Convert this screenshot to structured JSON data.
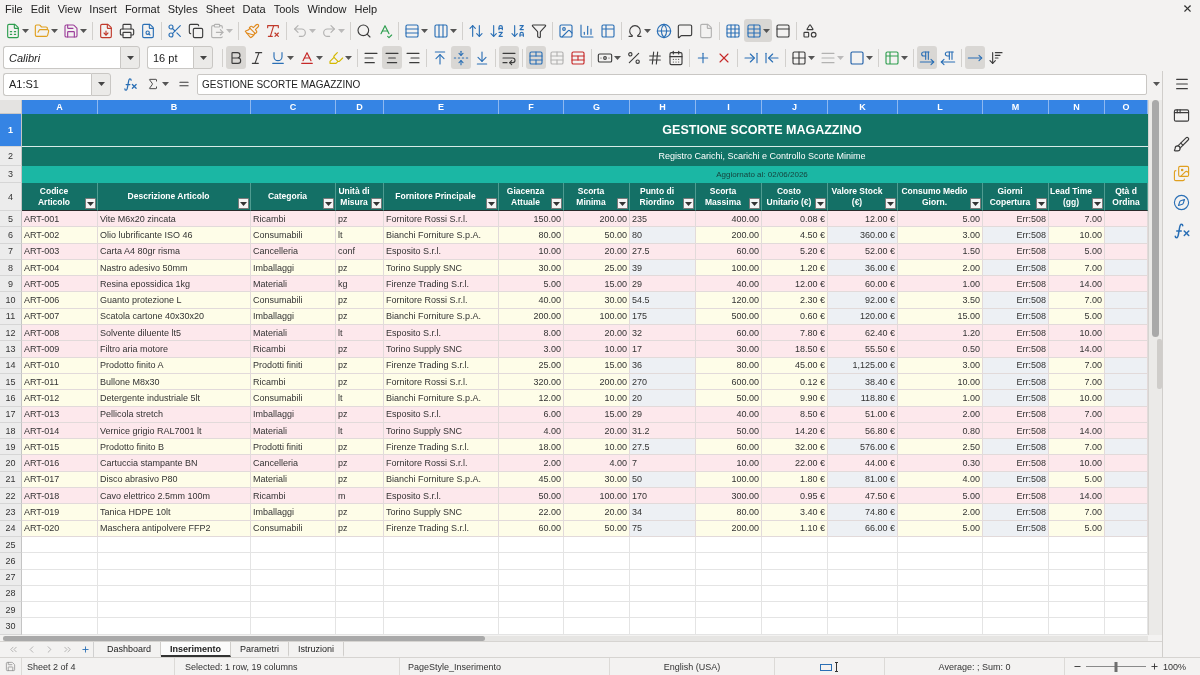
{
  "menu_bar": [
    "File",
    "Edit",
    "View",
    "Insert",
    "Format",
    "Styles",
    "Sheet",
    "Data",
    "Tools",
    "Window",
    "Help"
  ],
  "standard_toolbar": [
    {
      "pressed": false,
      "disabled": false,
      "dropdown": true
    },
    {
      "pressed": false,
      "disabled": false,
      "dropdown": true
    },
    {
      "pressed": false,
      "disabled": false,
      "dropdown": true
    },
    {
      "pressed": false,
      "disabled": false,
      "dropdown": false
    },
    {
      "pressed": false,
      "disabled": false,
      "dropdown": false
    },
    {
      "pressed": false,
      "disabled": false,
      "dropdown": false
    },
    {
      "pressed": false,
      "disabled": false,
      "dropdown": false
    },
    {
      "pressed": false,
      "disabled": false,
      "dropdown": false
    },
    {
      "pressed": false,
      "disabled": true,
      "dropdown": true
    },
    {
      "pressed": false,
      "disabled": false,
      "dropdown": false
    },
    {
      "pressed": false,
      "disabled": false,
      "dropdown": false
    },
    {
      "pressed": false,
      "disabled": true,
      "dropdown": true
    },
    {
      "pressed": false,
      "disabled": true,
      "dropdown": true
    },
    {
      "pressed": false,
      "disabled": false,
      "dropdown": false
    },
    {
      "pressed": false,
      "disabled": false,
      "dropdown": false
    },
    {
      "pressed": false,
      "disabled": false,
      "dropdown": true
    },
    {
      "pressed": false,
      "disabled": false,
      "dropdown": true
    },
    {
      "pressed": false,
      "disabled": false,
      "dropdown": false
    },
    {
      "pressed": false,
      "disabled": false,
      "dropdown": false
    },
    {
      "pressed": false,
      "disabled": false,
      "dropdown": false
    },
    {
      "pressed": false,
      "disabled": false,
      "dropdown": false
    },
    {
      "pressed": false,
      "disabled": false,
      "dropdown": false
    },
    {
      "pressed": false,
      "disabled": false,
      "dropdown": false
    },
    {
      "pressed": false,
      "disabled": false,
      "dropdown": false
    },
    {
      "pressed": false,
      "disabled": false,
      "dropdown": true
    },
    {
      "pressed": false,
      "disabled": false,
      "dropdown": false
    },
    {
      "pressed": false,
      "disabled": false,
      "dropdown": false
    },
    {
      "pressed": false,
      "disabled": true,
      "dropdown": false
    },
    {
      "pressed": false,
      "disabled": false,
      "dropdown": false
    },
    {
      "pressed": true,
      "disabled": false,
      "dropdown": true
    },
    {
      "pressed": false,
      "disabled": false,
      "dropdown": false
    },
    {
      "pressed": false,
      "disabled": false,
      "dropdown": false
    }
  ],
  "formatting_toolbar": {
    "font_name": "Calibri",
    "font_size": "16 pt",
    "buttons": [
      {
        "pressed": true,
        "disabled": false,
        "dropdown": false
      },
      {
        "pressed": false,
        "disabled": false,
        "dropdown": false
      },
      {
        "pressed": false,
        "disabled": false,
        "dropdown": true
      },
      {
        "pressed": false,
        "disabled": false,
        "dropdown": true
      },
      {
        "pressed": false,
        "disabled": false,
        "dropdown": true
      },
      {
        "pressed": false,
        "disabled": false,
        "dropdown": false
      },
      {
        "pressed": true,
        "disabled": false,
        "dropdown": false
      },
      {
        "pressed": false,
        "disabled": false,
        "dropdown": false
      },
      {
        "pressed": false,
        "disabled": false,
        "dropdown": false
      },
      {
        "pressed": true,
        "disabled": false,
        "dropdown": false
      },
      {
        "pressed": false,
        "disabled": false,
        "dropdown": false
      },
      {
        "pressed": true,
        "disabled": false,
        "dropdown": false
      },
      {
        "pressed": true,
        "disabled": false,
        "dropdown": false
      },
      {
        "pressed": false,
        "disabled": true,
        "dropdown": false
      },
      {
        "pressed": false,
        "disabled": false,
        "dropdown": false
      },
      {
        "pressed": false,
        "disabled": false,
        "dropdown": true
      },
      {
        "pressed": false,
        "disabled": false,
        "dropdown": false
      },
      {
        "pressed": false,
        "disabled": false,
        "dropdown": false
      },
      {
        "pressed": false,
        "disabled": false,
        "dropdown": false
      },
      {
        "pressed": false,
        "disabled": false,
        "dropdown": false
      },
      {
        "pressed": false,
        "disabled": false,
        "dropdown": false
      },
      {
        "pressed": false,
        "disabled": false,
        "dropdown": false
      },
      {
        "pressed": false,
        "disabled": false,
        "dropdown": false
      },
      {
        "pressed": false,
        "disabled": false,
        "dropdown": true
      },
      {
        "pressed": false,
        "disabled": true,
        "dropdown": true
      },
      {
        "pressed": false,
        "disabled": false,
        "dropdown": true
      },
      {
        "pressed": false,
        "disabled": false,
        "dropdown": true
      },
      {
        "pressed": true,
        "disabled": false,
        "dropdown": false
      },
      {
        "pressed": false,
        "disabled": false,
        "dropdown": false
      },
      {
        "pressed": true,
        "disabled": false,
        "dropdown": false
      },
      {
        "pressed": false,
        "disabled": false,
        "dropdown": false
      }
    ]
  },
  "formula_bar": {
    "name_box": "A1:S1",
    "formula": "GESTIONE SCORTE MAGAZZINO"
  },
  "sheet": {
    "columns": [
      {
        "letter": "A",
        "selected": true,
        "shaded": false
      },
      {
        "letter": "B",
        "selected": true,
        "shaded": false
      },
      {
        "letter": "C",
        "selected": true,
        "shaded": false
      },
      {
        "letter": "D",
        "selected": true,
        "shaded": false
      },
      {
        "letter": "E",
        "selected": true,
        "shaded": false
      },
      {
        "letter": "F",
        "selected": true,
        "shaded": false
      },
      {
        "letter": "G",
        "selected": true,
        "shaded": false
      },
      {
        "letter": "H",
        "selected": true,
        "shaded": true
      },
      {
        "letter": "I",
        "selected": true,
        "shaded": false
      },
      {
        "letter": "J",
        "selected": true,
        "shaded": false
      },
      {
        "letter": "K",
        "selected": true,
        "shaded": true
      },
      {
        "letter": "L",
        "selected": true,
        "shaded": false
      },
      {
        "letter": "M",
        "selected": true,
        "shaded": true
      },
      {
        "letter": "N",
        "selected": true,
        "shaded": false
      },
      {
        "letter": "O",
        "selected": true,
        "shaded": true
      }
    ],
    "title_rows": [
      {
        "number": "1",
        "selected": true,
        "kind": "title",
        "text": "GESTIONE SCORTE MAGAZZINO"
      },
      {
        "number": "2",
        "selected": false,
        "kind": "subtitle",
        "text": "Registro Carichi, Scarichi e Controllo Scorte Minime"
      },
      {
        "number": "3",
        "selected": false,
        "kind": "note",
        "text": "Aggiornato al: 02/06/2026"
      }
    ],
    "header_row": {
      "number": "4",
      "selected": false,
      "cells": [
        {
          "label": "Codice\nArticolo",
          "filter": true
        },
        {
          "label": "Descrizione Articolo",
          "filter": true
        },
        {
          "label": "Categoria",
          "filter": true
        },
        {
          "label": "Unità di\nMisura",
          "filter": true
        },
        {
          "label": "Fornitore Principale",
          "filter": true
        },
        {
          "label": "Giacenza\nAttuale",
          "filter": true
        },
        {
          "label": "Scorta\nMinima",
          "filter": true
        },
        {
          "label": "Punto di\nRiordino",
          "filter": true
        },
        {
          "label": "Scorta\nMassima",
          "filter": true
        },
        {
          "label": "Costo\nUnitario (€)",
          "filter": true
        },
        {
          "label": "Valore Stock\n(€)",
          "filter": true
        },
        {
          "label": "Consumo Medio\nGiorn.",
          "filter": true
        },
        {
          "label": "Giorni\nCopertura",
          "filter": true
        },
        {
          "label": "Lead Time\n(gg)",
          "filter": true
        },
        {
          "label": "Qtà d\nOrdina",
          "filter": false
        }
      ]
    },
    "rows": [
      {
        "number": "5",
        "selected": false,
        "highlighted": true,
        "cells": [
          "ART-001",
          "Vite M6x20 zincata",
          "Ricambi",
          "pz",
          "Fornitore Rossi S.r.l.",
          "150.00",
          "200.00",
          "235",
          "400.00",
          "0.08 €",
          "12.00 €",
          "5.00",
          "Err:508",
          "7.00"
        ]
      },
      {
        "number": "6",
        "selected": false,
        "highlighted": false,
        "cells": [
          "ART-002",
          "Olio lubrificante ISO 46",
          "Consumabili",
          "lt",
          "Bianchi Forniture S.p.A.",
          "80.00",
          "50.00",
          "80",
          "200.00",
          "4.50 €",
          "360.00 €",
          "3.00",
          "Err:508",
          "10.00"
        ]
      },
      {
        "number": "7",
        "selected": false,
        "highlighted": true,
        "cells": [
          "ART-003",
          "Carta A4 80gr risma",
          "Cancelleria",
          "conf",
          "Esposito S.r.l.",
          "10.00",
          "20.00",
          "27.5",
          "60.00",
          "5.20 €",
          "52.00 €",
          "1.50",
          "Err:508",
          "5.00"
        ]
      },
      {
        "number": "8",
        "selected": false,
        "highlighted": false,
        "cells": [
          "ART-004",
          "Nastro adesivo 50mm",
          "Imballaggi",
          "pz",
          "Torino Supply SNC",
          "30.00",
          "25.00",
          "39",
          "100.00",
          "1.20 €",
          "36.00 €",
          "2.00",
          "Err:508",
          "7.00"
        ]
      },
      {
        "number": "9",
        "selected": false,
        "highlighted": true,
        "cells": [
          "ART-005",
          "Resina epossidica 1kg",
          "Materiali",
          "kg",
          "Firenze Trading S.r.l.",
          "5.00",
          "15.00",
          "29",
          "40.00",
          "12.00 €",
          "60.00 €",
          "1.00",
          "Err:508",
          "14.00"
        ]
      },
      {
        "number": "10",
        "selected": false,
        "highlighted": false,
        "cells": [
          "ART-006",
          "Guanto protezione L",
          "Consumabili",
          "pz",
          "Fornitore Rossi S.r.l.",
          "40.00",
          "30.00",
          "54.5",
          "120.00",
          "2.30 €",
          "92.00 €",
          "3.50",
          "Err:508",
          "7.00"
        ]
      },
      {
        "number": "11",
        "selected": false,
        "highlighted": false,
        "cells": [
          "ART-007",
          "Scatola cartone 40x30x20",
          "Imballaggi",
          "pz",
          "Bianchi Forniture S.p.A.",
          "200.00",
          "100.00",
          "175",
          "500.00",
          "0.60 €",
          "120.00 €",
          "15.00",
          "Err:508",
          "5.00"
        ]
      },
      {
        "number": "12",
        "selected": false,
        "highlighted": true,
        "cells": [
          "ART-008",
          "Solvente diluente lt5",
          "Materiali",
          "lt",
          "Esposito S.r.l.",
          "8.00",
          "20.00",
          "32",
          "60.00",
          "7.80 €",
          "62.40 €",
          "1.20",
          "Err:508",
          "10.00"
        ]
      },
      {
        "number": "13",
        "selected": false,
        "highlighted": true,
        "cells": [
          "ART-009",
          "Filtro aria motore",
          "Ricambi",
          "pz",
          "Torino Supply SNC",
          "3.00",
          "10.00",
          "17",
          "30.00",
          "18.50 €",
          "55.50 €",
          "0.50",
          "Err:508",
          "14.00"
        ]
      },
      {
        "number": "14",
        "selected": false,
        "highlighted": false,
        "cells": [
          "ART-010",
          "Prodotto finito A",
          "Prodotti finiti",
          "pz",
          "Firenze Trading S.r.l.",
          "25.00",
          "15.00",
          "36",
          "80.00",
          "45.00 €",
          "1,125.00 €",
          "3.00",
          "Err:508",
          "7.00"
        ]
      },
      {
        "number": "15",
        "selected": false,
        "highlighted": false,
        "cells": [
          "ART-011",
          "Bullone M8x30",
          "Ricambi",
          "pz",
          "Fornitore Rossi S.r.l.",
          "320.00",
          "200.00",
          "270",
          "600.00",
          "0.12 €",
          "38.40 €",
          "10.00",
          "Err:508",
          "7.00"
        ]
      },
      {
        "number": "16",
        "selected": false,
        "highlighted": false,
        "cells": [
          "ART-012",
          "Detergente industriale 5lt",
          "Consumabili",
          "lt",
          "Bianchi Forniture S.p.A.",
          "12.00",
          "10.00",
          "20",
          "50.00",
          "9.90 €",
          "118.80 €",
          "1.00",
          "Err:508",
          "10.00"
        ]
      },
      {
        "number": "17",
        "selected": false,
        "highlighted": true,
        "cells": [
          "ART-013",
          "Pellicola stretch",
          "Imballaggi",
          "pz",
          "Esposito S.r.l.",
          "6.00",
          "15.00",
          "29",
          "40.00",
          "8.50 €",
          "51.00 €",
          "2.00",
          "Err:508",
          "7.00"
        ]
      },
      {
        "number": "18",
        "selected": false,
        "highlighted": true,
        "cells": [
          "ART-014",
          "Vernice grigio RAL7001 lt",
          "Materiali",
          "lt",
          "Torino Supply SNC",
          "4.00",
          "20.00",
          "31.2",
          "50.00",
          "14.20 €",
          "56.80 €",
          "0.80",
          "Err:508",
          "14.00"
        ]
      },
      {
        "number": "19",
        "selected": false,
        "highlighted": false,
        "cells": [
          "ART-015",
          "Prodotto finito B",
          "Prodotti finiti",
          "pz",
          "Firenze Trading S.r.l.",
          "18.00",
          "10.00",
          "27.5",
          "60.00",
          "32.00 €",
          "576.00 €",
          "2.50",
          "Err:508",
          "7.00"
        ]
      },
      {
        "number": "20",
        "selected": false,
        "highlighted": true,
        "cells": [
          "ART-016",
          "Cartuccia stampante BN",
          "Cancelleria",
          "pz",
          "Fornitore Rossi S.r.l.",
          "2.00",
          "4.00",
          "7",
          "10.00",
          "22.00 €",
          "44.00 €",
          "0.30",
          "Err:508",
          "10.00"
        ]
      },
      {
        "number": "21",
        "selected": false,
        "highlighted": false,
        "cells": [
          "ART-017",
          "Disco abrasivo P80",
          "Materiali",
          "pz",
          "Bianchi Forniture S.p.A.",
          "45.00",
          "30.00",
          "50",
          "100.00",
          "1.80 €",
          "81.00 €",
          "4.00",
          "Err:508",
          "5.00"
        ]
      },
      {
        "number": "22",
        "selected": false,
        "highlighted": true,
        "cells": [
          "ART-018",
          "Cavo elettrico 2.5mm 100m",
          "Ricambi",
          "m",
          "Esposito S.r.l.",
          "50.00",
          "100.00",
          "170",
          "300.00",
          "0.95 €",
          "47.50 €",
          "5.00",
          "Err:508",
          "14.00"
        ]
      },
      {
        "number": "23",
        "selected": false,
        "highlighted": false,
        "cells": [
          "ART-019",
          "Tanica HDPE 10lt",
          "Imballaggi",
          "pz",
          "Torino Supply SNC",
          "22.00",
          "20.00",
          "34",
          "80.00",
          "3.40 €",
          "74.80 €",
          "2.00",
          "Err:508",
          "7.00"
        ]
      },
      {
        "number": "24",
        "selected": false,
        "highlighted": false,
        "cells": [
          "ART-020",
          "Maschera antipolvere FFP2",
          "Consumabili",
          "pz",
          "Firenze Trading S.r.l.",
          "60.00",
          "50.00",
          "75",
          "200.00",
          "1.10 €",
          "66.00 €",
          "5.00",
          "Err:508",
          "5.00"
        ]
      }
    ],
    "empty_rows": [
      {
        "number": "25",
        "selected": false
      },
      {
        "number": "26",
        "selected": false
      },
      {
        "number": "27",
        "selected": false
      },
      {
        "number": "28",
        "selected": false
      },
      {
        "number": "29",
        "selected": false
      },
      {
        "number": "30",
        "selected": false
      }
    ]
  },
  "sheet_tabs": [
    {
      "label": "Dashboard",
      "selected": false
    },
    {
      "label": "Inserimento",
      "selected": true
    },
    {
      "label": "Parametri",
      "selected": false
    },
    {
      "label": "Istruzioni",
      "selected": false
    }
  ],
  "status_bar": {
    "sheet": "Sheet 2 of 4",
    "selection": "Selected: 1 row, 19 columns",
    "page_style": "PageStyle_Inserimento",
    "language": "English (USA)",
    "summary": "Average: ; Sum: 0",
    "zoom": {
      "level": 0.5,
      "reading": "100%"
    }
  }
}
